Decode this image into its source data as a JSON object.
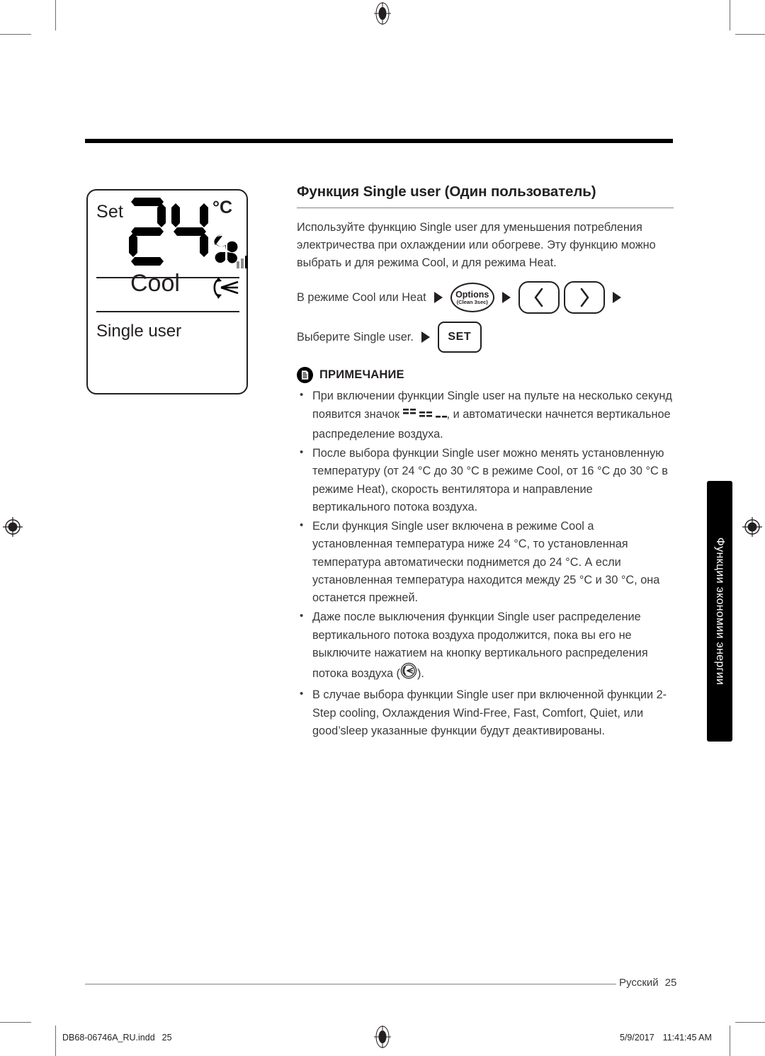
{
  "document": {
    "page_number": "25",
    "language_label": "Русский",
    "side_tab_label": "Функции экономии энергии",
    "imprint_file": "DB68-06746A_RU.indd",
    "imprint_page": "25",
    "imprint_date": "5/9/2017",
    "imprint_time": "11:41:45 AM"
  },
  "lcd": {
    "set_label": "Set",
    "temperature": "24",
    "unit": "°C",
    "mode": "Cool",
    "function": "Single user",
    "fan_icon": "fan-icon",
    "fan_speed_bars": "fan-speed-bars-icon",
    "swing_icon": "vertical-airflow-icon"
  },
  "section": {
    "heading": "Функция Single user (Один пользователь)",
    "intro": "Используйте функцию Single user для уменьшения потребления электричества при охлаждении или обогреве. Эту функцию можно выбрать и для режима Cool, и для режима Heat."
  },
  "steps": [
    {
      "label": "В режиме Cool или Heat",
      "options_button": {
        "title": "Options",
        "subtitle": "(Clean 3sec)"
      },
      "left_arrow": "‹",
      "right_arrow": "›"
    },
    {
      "label": "Выберите Single user.",
      "set_button": "SET"
    }
  ],
  "note": {
    "icon": "note-document-icon",
    "title": "ПРИМЕЧАНИЕ",
    "items": [
      {
        "before": "При включении функции Single user на пульте на несколько секунд появится значок ",
        "inline_icon": "single-user-dashes-icon",
        "after": ", и автоматически начнется вертикальное распределение воздуха."
      },
      {
        "text": "После выбора функции Single user можно менять установленную температуру (от 24 °C до 30 °C в режиме Cool, от 16 °C до 30 °C в режиме Heat), скорость вентилятора и направление вертикального потока воздуха."
      },
      {
        "text": "Если функция Single user включена в режиме Cool a установленная температура ниже 24 °C, то установленная температура автоматически поднимется до 24 °C. А если установленная температура находится между 25 °C и 30 °C, она останется прежней."
      },
      {
        "before": "Даже после выключения функции Single user распределение вертикального потока воздуха продолжится, пока вы его не выключите нажатием на кнопку вертикального распределения потока воздуха (",
        "inline_icon": "vertical-airflow-button-icon",
        "after": ")."
      },
      {
        "text": "В случае выбора функции Single user при включенной функции 2-Step cooling, Охлаждения Wind-Free, Fast, Comfort, Quiet, или good’sleep указанные функции будут деактивированы."
      }
    ]
  },
  "colors": {
    "ink": "#231f20",
    "body_text": "#3b3b3d",
    "rule": "#808285",
    "tab_bg": "#000000",
    "tab_text": "#ffffff"
  }
}
